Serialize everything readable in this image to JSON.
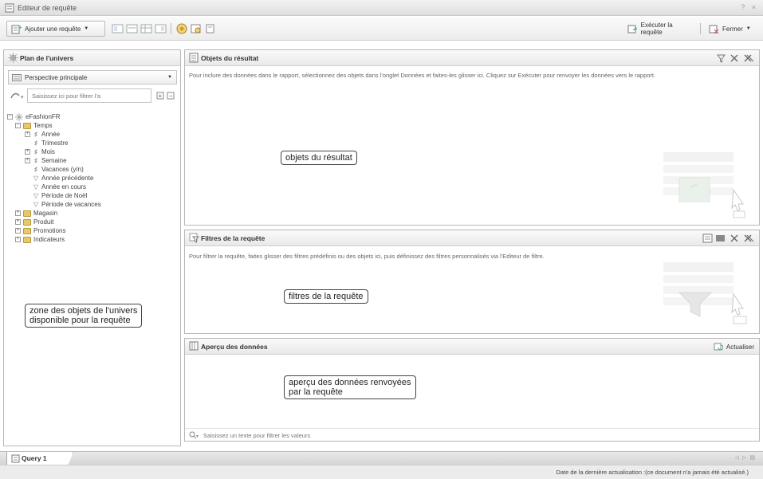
{
  "window": {
    "title": "Editeur de requête",
    "controls": "? ×"
  },
  "toolbar": {
    "add_query_label": "Ajouter une requête",
    "run_query_label": "Exécuter la requête",
    "close_label": "Fermer"
  },
  "universe_panel": {
    "title": "Plan de l'univers",
    "perspective_value": "Perspective principale",
    "filter_placeholder": "Saisissez ici pour filtrer l'a",
    "tree": [
      {
        "label": "eFashionFR",
        "level": 0,
        "expander": "−",
        "icon": "universe-icon"
      },
      {
        "label": "Temps",
        "level": 1,
        "expander": "−",
        "icon": "folder-icon"
      },
      {
        "label": "Année",
        "level": 2,
        "expander": "+",
        "icon": "dimension-icon"
      },
      {
        "label": "Trimestre",
        "level": 2,
        "expander": "",
        "icon": "dimension-icon"
      },
      {
        "label": "Mois",
        "level": 2,
        "expander": "+",
        "icon": "dimension-icon"
      },
      {
        "label": "Semaine",
        "level": 2,
        "expander": "+",
        "icon": "dimension-icon"
      },
      {
        "label": "Vacances (y/n)",
        "level": 2,
        "expander": "",
        "icon": "dimension-icon"
      },
      {
        "label": "Année précédente",
        "level": 2,
        "expander": "",
        "icon": "filter-icon"
      },
      {
        "label": "Année en cours",
        "level": 2,
        "expander": "",
        "icon": "filter-icon"
      },
      {
        "label": "Période de Noël",
        "level": 2,
        "expander": "",
        "icon": "filter-icon"
      },
      {
        "label": "Période de vacances",
        "level": 2,
        "expander": "",
        "icon": "filter-icon"
      },
      {
        "label": "Magasin",
        "level": 1,
        "expander": "+",
        "icon": "folder-icon"
      },
      {
        "label": "Produit",
        "level": 1,
        "expander": "+",
        "icon": "folder-icon"
      },
      {
        "label": "Promotions",
        "level": 1,
        "expander": "+",
        "icon": "folder-icon"
      },
      {
        "label": "Indicateurs",
        "level": 1,
        "expander": "+",
        "icon": "folder-icon"
      }
    ],
    "callout": "zone des objets de l'univers\ndisponible pour la requête"
  },
  "result_panel": {
    "title": "Objets du résultat",
    "description": "Pour inclure des données dans le rapport, sélectionnez des objets dans l'onglet Données et faites-les glisser ici. Cliquez sur Exécuter pour renvoyer les données vers le rapport.",
    "callout": "objets du résultat"
  },
  "filters_panel": {
    "title": "Filtres de la requête",
    "description": "Pour filtrer la requête, faites glisser des filtres prédéfinis ou des objets ici, puis définissez des filtres personnalisés via l'Editeur de filtre.",
    "callout": "filtres de la requête"
  },
  "preview_panel": {
    "title": "Aperçu des données",
    "refresh_label": "Actualiser",
    "callout": "aperçu des données renvoyées\npar la requête",
    "search_placeholder": "Saisissez un texte pour filtrer les valeurs"
  },
  "tabs": [
    {
      "label": "Query 1"
    }
  ],
  "status": {
    "text": "Date de la dernière actualisation :(ce document n'a jamais été actualisé.)"
  }
}
